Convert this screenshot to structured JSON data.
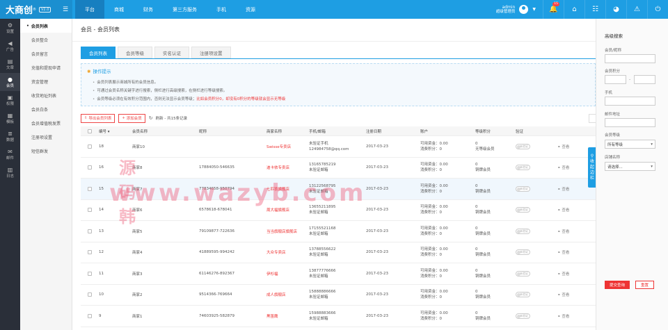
{
  "logo": {
    "text": "大商创",
    "reg": "®",
    "version": "V2.0"
  },
  "topnav": {
    "items": [
      {
        "label": "平台",
        "active": true
      },
      {
        "label": "商城",
        "active": false
      },
      {
        "label": "财务",
        "active": false
      },
      {
        "label": "第三方服务",
        "active": false
      },
      {
        "label": "手机",
        "active": false
      },
      {
        "label": "资源",
        "active": false
      }
    ]
  },
  "user": {
    "name": "admin",
    "role": "超级管理员"
  },
  "notifications": {
    "count": "15"
  },
  "leftbar": {
    "items": [
      {
        "label": "设置",
        "icon": "gear-icon"
      },
      {
        "label": "广告",
        "icon": "megaphone-icon"
      },
      {
        "label": "文章",
        "icon": "document-icon"
      },
      {
        "label": "会员",
        "icon": "user-icon",
        "active": true
      },
      {
        "label": "权限",
        "icon": "lock-icon"
      },
      {
        "label": "模板",
        "icon": "template-icon"
      },
      {
        "label": "数据",
        "icon": "database-icon"
      },
      {
        "label": "邮件",
        "icon": "mail-icon"
      },
      {
        "label": "日志",
        "icon": "log-icon"
      }
    ]
  },
  "subnav": {
    "items": [
      {
        "label": "会员列表",
        "active": true
      },
      {
        "label": "会员整合"
      },
      {
        "label": "会员留言"
      },
      {
        "label": "充值和提现申请"
      },
      {
        "label": "资金管理"
      },
      {
        "label": "收货地址列表"
      },
      {
        "label": "会员白条"
      },
      {
        "label": "会员增值税发票"
      },
      {
        "label": "注册项设置"
      },
      {
        "label": "短信群发"
      }
    ]
  },
  "page": {
    "title": "会员 - 会员列表"
  },
  "tabs": [
    {
      "label": "会员列表",
      "active": true
    },
    {
      "label": "会员等级"
    },
    {
      "label": "实名认证"
    },
    {
      "label": "注册项设置"
    }
  ],
  "tips": {
    "title": "操作提示",
    "lines": [
      {
        "text": "会员列表展示商城所有的会员信息。",
        "red": ""
      },
      {
        "text": "可通过会员名称关键字进行搜索，侧栏进行高级搜索，在侧栏进行等级搜索。",
        "red": ""
      },
      {
        "text": "会员等级必须在有效积分范围内，否则无法显示会员等级；",
        "red": "比如会员积分0，却没有0积分的等级就会显示无等级"
      }
    ]
  },
  "toolbar": {
    "export_label": "导出会员列表",
    "add_label": "添加会员",
    "refresh_label": "刷新 - 共15条记录"
  },
  "table": {
    "headers": [
      "编号",
      "会员名称",
      "昵称",
      "商家名称",
      "手机/邮箱",
      "注册日期",
      "账户",
      "等级积分",
      "验证",
      ""
    ],
    "rows": [
      {
        "id": "18",
        "name": "商家10",
        "nick": "",
        "shop": "Swisse专卖店",
        "contact1": "未验证手机",
        "contact2": "124984758@qq.com",
        "date": "2017-03-23",
        "acc1": "可用资金：0.00",
        "acc2": "消费积分：0",
        "points": "0",
        "level": "无等级会员",
        "verify": "未验证",
        "action": "查看"
      },
      {
        "id": "16",
        "name": "商家8",
        "nick": "17884050-546635",
        "shop": "迪卡侬专卖店",
        "contact1": "13165785219",
        "contact2": "未验证邮箱",
        "date": "2017-03-23",
        "acc1": "可用资金：0.00",
        "acc2": "消费积分：0",
        "points": "0",
        "level": "铜牌会员",
        "verify": "未验证",
        "action": "查看"
      },
      {
        "id": "15",
        "name": "商家7",
        "nick": "77834658-950794",
        "shop": "七匹狼旗舰店",
        "contact1": "13122568795",
        "contact2": "未验证邮箱",
        "date": "2017-03-23",
        "acc1": "可用资金：0.00",
        "acc2": "消费积分：0",
        "points": "0",
        "level": "铜牌会员",
        "verify": "未验证",
        "action": "查看",
        "hl": true
      },
      {
        "id": "14",
        "name": "商家6",
        "nick": "6578618-678041",
        "shop": "周大福旗舰店",
        "contact1": "13655211895",
        "contact2": "未验证邮箱",
        "date": "2017-03-23",
        "acc1": "可用资金：0.00",
        "acc2": "消费积分：0",
        "points": "0",
        "level": "铜牌会员",
        "verify": "未验证",
        "action": "查看"
      },
      {
        "id": "13",
        "name": "商家5",
        "nick": "79109877-722636",
        "shop": "当当旗舰店旗舰店",
        "contact1": "17155521168",
        "contact2": "未验证邮箱",
        "date": "2017-03-23",
        "acc1": "可用资金：0.00",
        "acc2": "消费积分：0",
        "points": "0",
        "level": "铜牌会员",
        "verify": "未验证",
        "action": "查看"
      },
      {
        "id": "12",
        "name": "商家4",
        "nick": "41889595-994242",
        "shop": "大众专卖店",
        "contact1": "13788556622",
        "contact2": "未验证邮箱",
        "date": "2017-03-23",
        "acc1": "可用资金：0.00",
        "acc2": "消费积分：0",
        "points": "0",
        "level": "铜牌会员",
        "verify": "未验证",
        "action": "查看"
      },
      {
        "id": "11",
        "name": "商家3",
        "nick": "61146276-892367",
        "shop": "伊杉福",
        "contact1": "13877776666",
        "contact2": "未验证邮箱",
        "date": "2017-03-23",
        "acc1": "可用资金：0.00",
        "acc2": "消费积分：0",
        "points": "0",
        "level": "铜牌会员",
        "verify": "未验证",
        "action": "查看"
      },
      {
        "id": "10",
        "name": "商家2",
        "nick": "9514366-769664",
        "shop": "成人旗舰店",
        "contact1": "15888886666",
        "contact2": "未验证邮箱",
        "date": "2017-03-23",
        "acc1": "可用资金：0.00",
        "acc2": "消费积分：0",
        "points": "0",
        "level": "铜牌会员",
        "verify": "未验证",
        "action": "查看"
      },
      {
        "id": "9",
        "name": "商家1",
        "nick": "74603925-582879",
        "shop": "黑笛鹰",
        "contact1": "15988883666",
        "contact2": "未验证邮箱",
        "date": "2017-03-23",
        "acc1": "可用资金：0.00",
        "acc2": "消费积分：0",
        "points": "0",
        "level": "铜牌会员",
        "verify": "未验证",
        "action": "查看"
      }
    ]
  },
  "rightpanel": {
    "title": "高级搜索",
    "name_label": "会员/昵称",
    "points_label": "会员积分",
    "points_dash": "-",
    "phone_label": "手机",
    "email_label": "邮件地址",
    "level_label": "会员等级",
    "level_value": "所有等级",
    "shop_label": "店铺名称",
    "shop_value": "请选择...",
    "submit_label": "提交查询",
    "reset_label": "重置"
  },
  "collapse_tab": {
    "line1": "收",
    "line2": "起",
    "line3": "边",
    "line4": "栏"
  },
  "watermark": {
    "cn": "源码韩",
    "url": "www.wazyb.com"
  },
  "colors": {
    "primary": "#1e9ee3",
    "danger": "#ee3333",
    "sidebar": "#2a2f39"
  }
}
